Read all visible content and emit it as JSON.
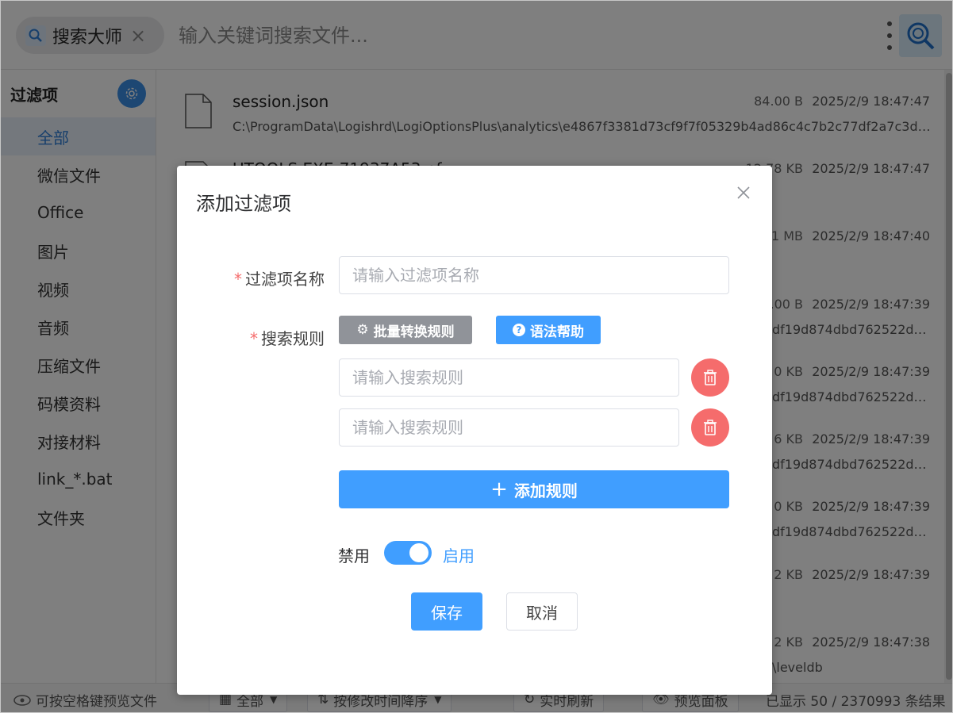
{
  "topbar": {
    "tag_label": "搜索大师",
    "search_placeholder": "输入关键词搜索文件..."
  },
  "sidebar": {
    "title": "过滤项",
    "items": [
      {
        "label": "全部",
        "active": true
      },
      {
        "label": "微信文件"
      },
      {
        "label": "Office"
      },
      {
        "label": "图片"
      },
      {
        "label": "视频"
      },
      {
        "label": "音频"
      },
      {
        "label": "压缩文件"
      },
      {
        "label": "码模资料"
      },
      {
        "label": "对接材料"
      },
      {
        "label": "link_*.bat"
      },
      {
        "label": "文件夹"
      }
    ]
  },
  "files": [
    {
      "name": "session.json",
      "path": "C:\\ProgramData\\Logishrd\\LogiOptionsPlus\\analytics\\e4867f3381d73cf9f7f05329b4ad86c4c7b2c77df2a7c3df4...",
      "size": "84.00 B",
      "time": "2025/2/9 18:47:47"
    },
    {
      "name": "UTOOLS.EXE-71937A53.pf",
      "path": "",
      "size": "12.78 KB",
      "time": "2025/2/9 18:47:47"
    },
    {
      "name": "",
      "path": "",
      "size": "1 MB",
      "time": "2025/2/9 18:47:40"
    },
    {
      "name": "",
      "path": "df19d874dbd762522dd...",
      "size": ".00 B",
      "time": "2025/2/9 18:47:39"
    },
    {
      "name": "",
      "path": "df19d874dbd762522dd...",
      "size": "0 KB",
      "time": "2025/2/9 18:47:39"
    },
    {
      "name": "",
      "path": "df19d874dbd762522dd...",
      "size": "6 KB",
      "time": "2025/2/9 18:47:39"
    },
    {
      "name": "",
      "path": "df19d874dbd762522dd...",
      "size": "0 KB",
      "time": "2025/2/9 18:47:39"
    },
    {
      "name": "",
      "path": "",
      "size": "2 KB",
      "time": "2025/2/9 18:47:39"
    },
    {
      "name": "",
      "path": "\\leveldb",
      "size": "2 KB",
      "time": "2025/2/9 18:47:38"
    }
  ],
  "bottombar": {
    "hint": "可按空格键预览文件",
    "filter": "全部",
    "sort": "按修改时间降序",
    "refresh": "实时刷新",
    "preview": "预览面板",
    "count": "已显示 50 / 2370993 条结果"
  },
  "dialog": {
    "title": "添加过滤项",
    "name_label": "过滤项名称",
    "name_placeholder": "请输入过滤项名称",
    "rules_label": "搜索规则",
    "batch_button": "批量转换规则",
    "help_button": "语法帮助",
    "rule_placeholder": "请输入搜索规则",
    "add_rule_button": "添加规则",
    "switch_off_label": "禁用",
    "switch_on_label": "启用",
    "switch_on": true,
    "save_button": "保存",
    "cancel_button": "取消"
  },
  "colors": {
    "primary": "#409eff",
    "danger": "#f56c6c",
    "gray_button": "#909399"
  }
}
